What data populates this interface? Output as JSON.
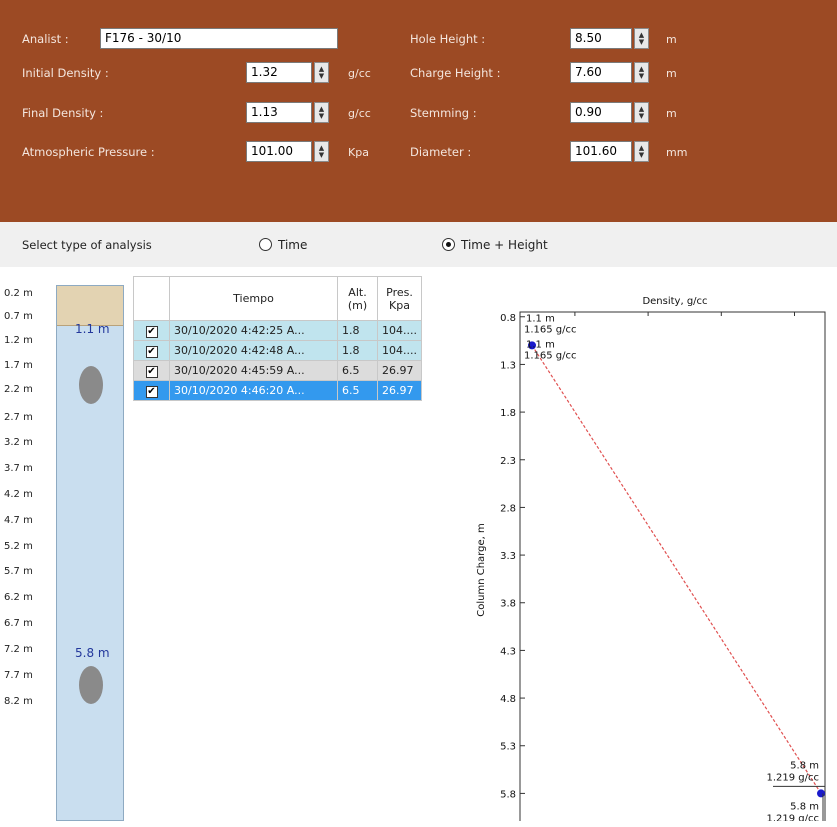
{
  "params": {
    "analist_label": "Analist :",
    "analist_value": "F176 - 30/10",
    "initial_density_label": "Initial Density :",
    "initial_density_value": "1.32",
    "initial_density_unit": "g/cc",
    "final_density_label": "Final Density :",
    "final_density_value": "1.13",
    "final_density_unit": "g/cc",
    "pressure_label": "Atmospheric Pressure :",
    "pressure_value": "101.00",
    "pressure_unit": "Kpa",
    "hole_height_label": "Hole Height :",
    "hole_height_value": "8.50",
    "hole_height_unit": "m",
    "charge_height_label": "Charge Height :",
    "charge_height_value": "7.60",
    "charge_height_unit": "m",
    "stemming_label": "Stemming :",
    "stemming_value": "0.90",
    "stemming_unit": "m",
    "diameter_label": "Diameter :",
    "diameter_value": "101.60",
    "diameter_unit": "mm"
  },
  "analysis": {
    "label": "Select type of analysis",
    "options": [
      "Time",
      "Time + Height"
    ],
    "selected": "Time + Height"
  },
  "column": {
    "scale": [
      "0.2 m",
      "0.7 m",
      "1.2 m",
      "1.7 m",
      "2.2 m",
      "2.7 m",
      "3.2 m",
      "3.7 m",
      "4.2 m",
      "4.7 m",
      "5.2 m",
      "5.7 m",
      "6.2 m",
      "6.7 m",
      "7.2 m",
      "7.7 m",
      "8.2 m"
    ],
    "markers": [
      "1.1 m",
      "5.8 m"
    ]
  },
  "table": {
    "headers": [
      "",
      "Tiempo",
      "Alt.\n(m)",
      "Pres.\nKpa"
    ],
    "header_tiempo": "Tiempo",
    "header_alt_1": "Alt.",
    "header_alt_2": "(m)",
    "header_pres_1": "Pres.",
    "header_pres_2": "Kpa",
    "rows": [
      {
        "checked": true,
        "tiempo": "30/10/2020 4:42:25 A...",
        "alt": "1.8",
        "pres": "104...."
      },
      {
        "checked": true,
        "tiempo": "30/10/2020 4:42:48 A...",
        "alt": "1.8",
        "pres": "104...."
      },
      {
        "checked": true,
        "tiempo": "30/10/2020 4:45:59 A...",
        "alt": "6.5",
        "pres": "26.97"
      },
      {
        "checked": true,
        "tiempo": "30/10/2020 4:46:20 A...",
        "alt": "6.5",
        "pres": "26.97"
      }
    ]
  },
  "chart_data": {
    "type": "line",
    "title": "Density, g/cc",
    "xlabel": "Density, g/cc",
    "ylabel": "Column Charge, m",
    "y_ticks": [
      0.8,
      1.3,
      1.8,
      2.3,
      2.8,
      3.3,
      3.8,
      4.3,
      4.8,
      5.3,
      5.8
    ],
    "y_tick_labels": [
      "0.8",
      "1.3",
      "1.8",
      "2.3",
      "2.8",
      "3.3",
      "3.8",
      "4.3",
      "4.8",
      "5.3",
      "5.8"
    ],
    "ylim": [
      0.75,
      6.1
    ],
    "series": [
      {
        "values": [
          {
            "x": 1.165,
            "y": 1.1
          },
          {
            "x": 1.219,
            "y": 5.8
          }
        ]
      }
    ],
    "point_labels": [
      {
        "value": "1.1 m",
        "density": "1.165 g/cc"
      },
      {
        "value": "1.1 m",
        "density": "1.165 g/cc"
      },
      {
        "value": "5.8 m",
        "density": "1.219 g/cc"
      },
      {
        "value": "5.8 m",
        "density": "1.219 g/cc"
      }
    ],
    "line_color": "#e05050",
    "marker_color": "#1a1acc"
  }
}
